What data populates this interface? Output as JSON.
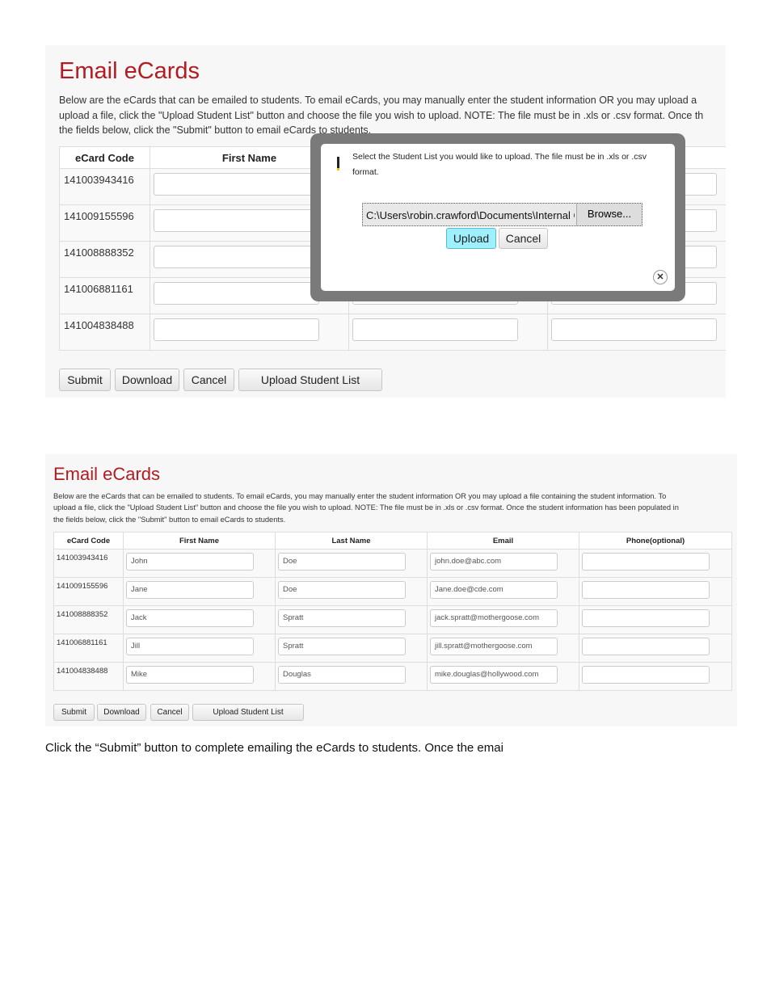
{
  "top": {
    "title": "Email eCards",
    "desc": [
      "Below are the eCards that can be emailed to students. To email eCards, you may manually enter the student information OR you may upload a",
      "upload a file, click the \"Upload Student List\" button and choose the file you wish to upload. NOTE: The file must be in .xls or .csv format. Once th",
      "the fields below, click the \"Submit\" button to email eCards to students."
    ],
    "headers": [
      "eCard Code",
      "First Name"
    ],
    "codes": [
      "141003943416",
      "141009155596",
      "141008888352",
      "141006881161",
      "141004838488"
    ],
    "buttons": {
      "submit": "Submit",
      "download": "Download",
      "cancel": "Cancel",
      "upload": "Upload Student List"
    },
    "modal": {
      "message_line1": "Select the Student List you would like to upload. The file must be in .xls or .csv",
      "message_line2": "format.",
      "file_path": "C:\\Users\\robin.crawford\\Documents\\Internal C",
      "browse": "Browse...",
      "upload": "Upload",
      "cancel": "Cancel",
      "icon": "warning-icon",
      "close_icon": "close-icon"
    }
  },
  "bottom": {
    "title": "Email eCards",
    "desc": [
      "Below are the eCards that can be emailed to students. To email eCards, you may manually enter the student information OR you may upload a file containing the student information. To",
      "upload a file, click the \"Upload Student List\" button and choose the file you wish to upload. NOTE: The file must be in .xls or .csv format. Once the student information has been populated in",
      "the fields below, click the \"Submit\" button to email eCards to students."
    ],
    "headers": [
      "eCard Code",
      "First Name",
      "Last Name",
      "Email",
      "Phone(optional)"
    ],
    "rows": [
      {
        "code": "141003943416",
        "first": "John",
        "last": "Doe",
        "email": "john.doe@abc.com",
        "phone": ""
      },
      {
        "code": "141009155596",
        "first": "Jane",
        "last": "Doe",
        "email": "Jane.doe@cde.com",
        "phone": ""
      },
      {
        "code": "141008888352",
        "first": "Jack",
        "last": "Spratt",
        "email": "jack.spratt@mothergoose.com",
        "phone": ""
      },
      {
        "code": "141006881161",
        "first": "Jill",
        "last": "Spratt",
        "email": "jill.spratt@mothergoose.com",
        "phone": ""
      },
      {
        "code": "141004838488",
        "first": "Mike",
        "last": "Douglas",
        "email": "mike.douglas@hollywood.com",
        "phone": ""
      }
    ],
    "buttons": {
      "submit": "Submit",
      "download": "Download",
      "cancel": "Cancel",
      "upload": "Upload Student List"
    }
  },
  "caption": "Click the “Submit” button to complete emailing the eCards to students. Once the emai",
  "colors": {
    "title": "#b01c22",
    "upload_button": "#9ef0ff"
  }
}
